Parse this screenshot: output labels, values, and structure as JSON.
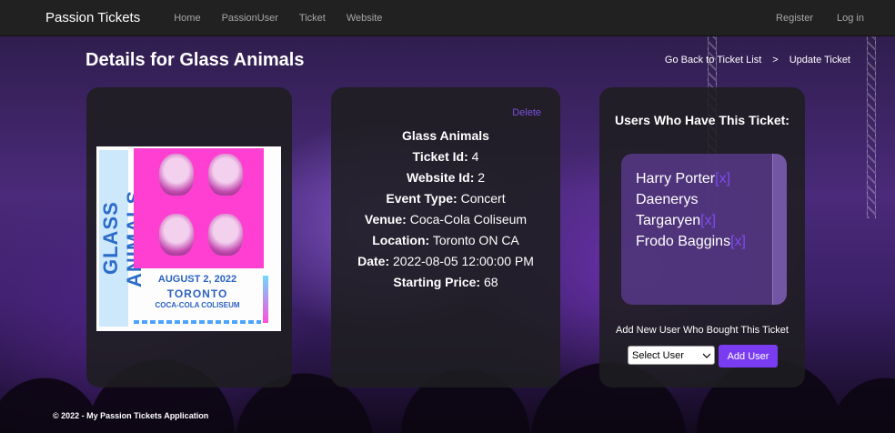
{
  "navbar": {
    "brand": "Passion Tickets",
    "links": [
      "Home",
      "PassionUser",
      "Ticket",
      "Website"
    ],
    "right_links": [
      "Register",
      "Log in"
    ]
  },
  "page": {
    "title": "Details for Glass Animals",
    "breadcrumbs": [
      "Go Back to Ticket List",
      ">",
      "Update Ticket"
    ]
  },
  "poster": {
    "side_text": "GLASS ANIMALS",
    "date": "AUGUST 2, 2022",
    "city": "TORONTO",
    "venue": "COCA-COLA COLISEUM"
  },
  "details": {
    "delete_label": "Delete",
    "name": "Glass Animals",
    "ticket_id_label": "Ticket Id:",
    "ticket_id": "4",
    "website_id_label": "Website Id:",
    "website_id": "2",
    "event_type_label": "Event Type:",
    "event_type": "Concert",
    "venue_label": "Venue:",
    "venue": "Coca-Cola Coliseum",
    "location_label": "Location:",
    "location": "Toronto ON CA",
    "date_label": "Date:",
    "date": "2022-08-05 12:00:00 PM",
    "price_label": "Starting Price:",
    "price": "68"
  },
  "users": {
    "title": "Users Who Have This Ticket:",
    "list": [
      {
        "line": "Harry Porter",
        "remove": "[x]"
      },
      {
        "line": "Daenerys",
        "remove": ""
      },
      {
        "line": "Targaryen",
        "remove": "[x]"
      },
      {
        "line": "Frodo Baggins",
        "remove": "[x]"
      }
    ],
    "add_label": "Add New User Who Bought This Ticket",
    "select_value": "Select User",
    "add_button": "Add User"
  },
  "footer": {
    "text": "© 2022 - My Passion Tickets Application"
  },
  "colors": {
    "navbar": "#212121",
    "accent": "#7a3cf0",
    "link_purple": "#7b4fe0"
  }
}
